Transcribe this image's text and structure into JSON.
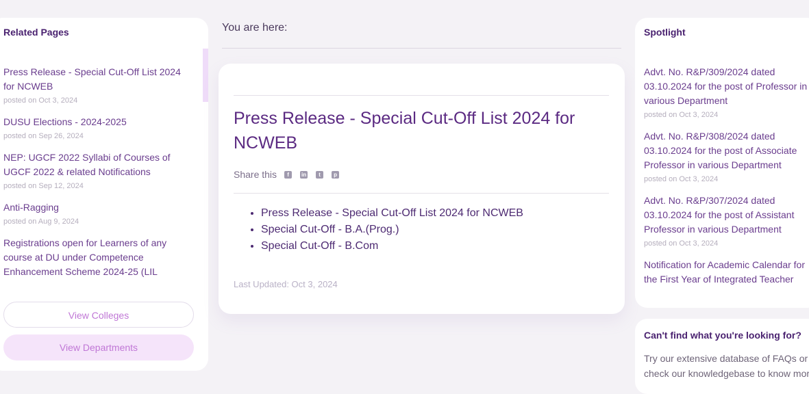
{
  "related": {
    "title": "Related Pages",
    "items": [
      {
        "title": "Press Release - Special Cut-Off List 2024 for NCWEB",
        "date": "posted on Oct 3, 2024"
      },
      {
        "title": "DUSU Elections - 2024-2025",
        "date": "posted on Sep 26, 2024"
      },
      {
        "title": "NEP: UGCF 2022 Syllabi of Courses of UGCF 2022 & related Notifications",
        "date": "posted on Sep 12, 2024"
      },
      {
        "title": "Anti-Ragging",
        "date": "posted on Aug 9, 2024"
      },
      {
        "title": "Registrations open for Learners of any course at DU under Competence Enhancement Scheme 2024-25 (LIL",
        "date": ""
      }
    ],
    "view_colleges": "View Colleges",
    "view_departments": "View Departments"
  },
  "breadcrumb": {
    "label": "You are here:"
  },
  "article": {
    "title": "Press Release - Special Cut-Off List 2024 for NCWEB",
    "share_label": "Share this",
    "share_icons": [
      "facebook-icon",
      "linkedin-icon",
      "twitter-icon",
      "pinterest-icon"
    ],
    "links": [
      "Press Release - Special Cut-Off List 2024 for NCWEB",
      "Special Cut-Off - B.A.(Prog.)",
      "Special Cut-Off - B.Com"
    ],
    "last_updated": "Last Updated: Oct 3, 2024"
  },
  "spotlight": {
    "title": "Spotlight",
    "items": [
      {
        "title": "Advt. No. R&P/309/2024 dated 03.10.2024 for the post of Professor in various Department",
        "date": "posted on Oct 3, 2024"
      },
      {
        "title": "Advt. No. R&P/308/2024 dated 03.10.2024 for the post of Associate Professor in various Department",
        "date": "posted on Oct 3, 2024"
      },
      {
        "title": "Advt. No. R&P/307/2024 dated 03.10.2024 for the post of Assistant Professor in various Department",
        "date": "posted on Oct 3, 2024"
      },
      {
        "title": "Notification for Academic Calendar for the First Year of Integrated Teacher",
        "date": ""
      }
    ]
  },
  "cant_find": {
    "title": "Can't find what you're looking for?",
    "body": "Try our extensive database of FAQs or check our knowledgebase to know more"
  },
  "colors": {
    "accent": "#5b2a82",
    "button_text": "#c077d6",
    "button_bg": "#f5e4fa"
  }
}
